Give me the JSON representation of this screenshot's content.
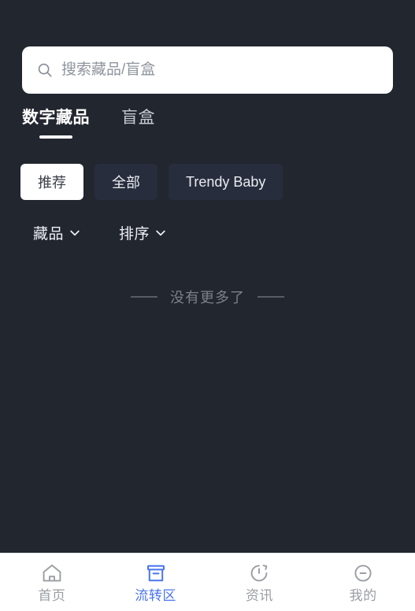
{
  "theme": {
    "background": "#22262f",
    "chip_bg": "#282d3d",
    "accent_blue": "#4a74f0",
    "muted_text": "#7b808b",
    "nav_bg": "#ffffff"
  },
  "search": {
    "icon": "search-icon",
    "placeholder": "搜索藏品/盲盒",
    "value": ""
  },
  "tabs": [
    {
      "label": "数字藏品",
      "active": true
    },
    {
      "label": "盲盒",
      "active": false
    }
  ],
  "chips": [
    {
      "label": "推荐",
      "active": true
    },
    {
      "label": "全部",
      "active": false
    },
    {
      "label": "Trendy Baby",
      "active": false
    }
  ],
  "filters": [
    {
      "label": "藏品",
      "icon": "chevron-down-icon"
    },
    {
      "label": "排序",
      "icon": "chevron-down-icon"
    }
  ],
  "empty_state": {
    "text": "没有更多了"
  },
  "bottom_nav": [
    {
      "label": "首页",
      "icon": "home-icon",
      "active": false
    },
    {
      "label": "流转区",
      "icon": "archive-box-icon",
      "active": true
    },
    {
      "label": "资讯",
      "icon": "clock-refresh-icon",
      "active": false
    },
    {
      "label": "我的",
      "icon": "minus-circle-icon",
      "active": false
    }
  ]
}
